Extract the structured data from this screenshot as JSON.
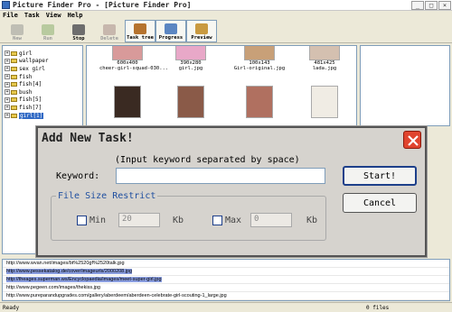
{
  "window": {
    "title": "Picture Finder Pro - [Picture Finder Pro]"
  },
  "menu": [
    "File",
    "Task",
    "View",
    "Help"
  ],
  "toolbar": [
    {
      "label": "New",
      "color": "#8a8a8a",
      "state": "disabled"
    },
    {
      "label": "Run",
      "color": "#7aa35a",
      "state": "disabled"
    },
    {
      "label": "Stop",
      "color": "#6d6d6d",
      "state": "normal"
    },
    {
      "label": "Delete",
      "color": "#9b7b7b",
      "state": "disabled"
    },
    {
      "label": "Task tree",
      "color": "#b5732e",
      "state": "pressed"
    },
    {
      "label": "Progress",
      "color": "#5b86c2",
      "state": "pressed"
    },
    {
      "label": "Preview",
      "color": "#c99a40",
      "state": "pressed"
    }
  ],
  "tree": [
    {
      "label": "girl",
      "selected": false
    },
    {
      "label": "wallpaper",
      "selected": false
    },
    {
      "label": "sex girl",
      "selected": false
    },
    {
      "label": "fish",
      "selected": false
    },
    {
      "label": "fish[4]",
      "selected": false
    },
    {
      "label": "bush",
      "selected": false
    },
    {
      "label": "fish[5]",
      "selected": false
    },
    {
      "label": "fish[7]",
      "selected": false
    },
    {
      "label": "girl[1]",
      "selected": true
    }
  ],
  "thumbnails": [
    {
      "caption": "600x400\ncheer-girl-squad-030...",
      "color": "#d89a9a"
    },
    {
      "caption": "390x280\ngirl.jpg",
      "color": "#e8a8c8"
    },
    {
      "caption": "100x143\nGirl-original.jpg",
      "color": "#c8a078"
    },
    {
      "caption": "481x425\nlada.jpg",
      "color": "#d4c0b0"
    },
    {
      "caption": "",
      "color": "#3a2a22"
    },
    {
      "caption": "",
      "color": "#8a5a48"
    },
    {
      "caption": "",
      "color": "#b07060"
    },
    {
      "caption": "",
      "color": "#f0ece4"
    }
  ],
  "dialog": {
    "title": "Add New Task!",
    "hint": "(Input keyword separated by space)",
    "keyword_label": "Keyword:",
    "keyword_value": "",
    "start_label": "Start!",
    "cancel_label": "Cancel",
    "size_legend": "File Size Restrict",
    "min_label": "Min",
    "min_value": "20",
    "max_label": "Max",
    "max_value": "0",
    "unit": "Kb"
  },
  "urls": [
    {
      "text": "http://www.wvan.net/images/bt%2520gf%2520talk.jpg",
      "highlighted": false
    },
    {
      "text": "http://www.pessekatalog.de/cover/imageurls/2000208.jpg",
      "highlighted": true
    },
    {
      "text": "http://theages.superman.ws/Encyclopaedia/images/meet-super-girl.jpg",
      "highlighted": true
    },
    {
      "text": "http://www.pegeen.com/images/thekiss.jpg",
      "highlighted": false
    },
    {
      "text": "http://www.pureparandupgrades.com/gallery/aberdeem/aberdeen-celebrate-girl-scouting-1_large.jpg",
      "highlighted": false
    }
  ],
  "status": {
    "left": "Ready",
    "right": "0 files"
  }
}
